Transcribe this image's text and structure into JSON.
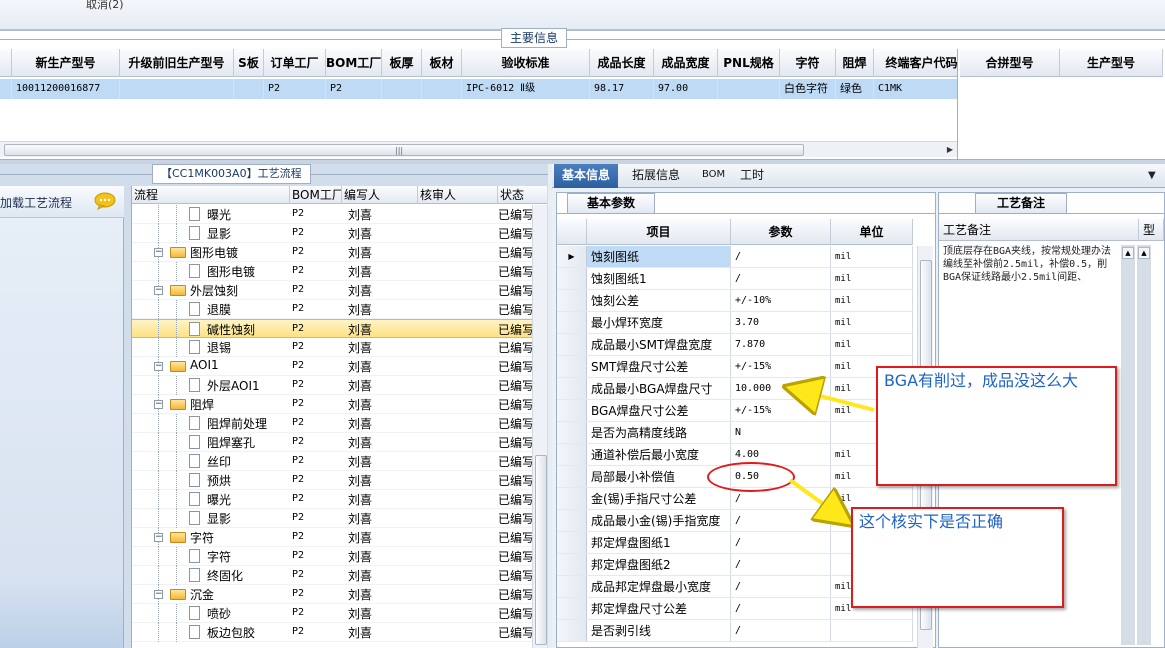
{
  "top": {
    "cancel_label": "取消(2)"
  },
  "main_info": {
    "legend": "主要信息",
    "columns": [
      "新生产型号",
      "升级前旧生产型号",
      "S板",
      "订单工厂",
      "BOM工厂",
      "板厚",
      "板材",
      "验收标准",
      "成品长度",
      "成品宽度",
      "PNL规格",
      "字符",
      "阻焊",
      "终端客户代码"
    ],
    "row": [
      "10011200016877",
      "",
      "",
      "P2",
      "P2",
      "",
      "",
      "IPC-6012 Ⅱ级",
      "98.17",
      "97.00",
      "",
      "白色字符",
      "绿色",
      "C1MK"
    ],
    "right_columns": [
      "合拼型号",
      "生产型号"
    ]
  },
  "flow": {
    "title": "【CC1MK003A0】工艺流程",
    "load_label": "加载工艺流程",
    "columns": [
      "流程",
      "BOM工厂",
      "编写人",
      "核审人",
      "状态"
    ],
    "rows": [
      {
        "name": "曝光",
        "level": 2,
        "type": "doc",
        "bom": "P2",
        "author": "刘喜",
        "status": "已编写"
      },
      {
        "name": "显影",
        "level": 2,
        "type": "doc",
        "bom": "P2",
        "author": "刘喜",
        "status": "已编写"
      },
      {
        "name": "图形电镀",
        "level": 1,
        "type": "folder",
        "bom": "P2",
        "author": "刘喜",
        "status": "已编写"
      },
      {
        "name": "图形电镀",
        "level": 2,
        "type": "doc",
        "bom": "P2",
        "author": "刘喜",
        "status": "已编写"
      },
      {
        "name": "外层蚀刻",
        "level": 1,
        "type": "folder",
        "bom": "P2",
        "author": "刘喜",
        "status": "已编写"
      },
      {
        "name": "退膜",
        "level": 2,
        "type": "doc",
        "bom": "P2",
        "author": "刘喜",
        "status": "已编写"
      },
      {
        "name": "碱性蚀刻",
        "level": 2,
        "type": "doc",
        "bom": "P2",
        "author": "刘喜",
        "status": "已编写",
        "selected": true
      },
      {
        "name": "退锡",
        "level": 2,
        "type": "doc",
        "bom": "P2",
        "author": "刘喜",
        "status": "已编写"
      },
      {
        "name": "AOI1",
        "level": 1,
        "type": "folder",
        "bom": "P2",
        "author": "刘喜",
        "status": "已编写"
      },
      {
        "name": "外层AOI1",
        "level": 2,
        "type": "doc",
        "bom": "P2",
        "author": "刘喜",
        "status": "已编写"
      },
      {
        "name": "阻焊",
        "level": 1,
        "type": "folder",
        "bom": "P2",
        "author": "刘喜",
        "status": "已编写"
      },
      {
        "name": "阻焊前处理",
        "level": 2,
        "type": "doc",
        "bom": "P2",
        "author": "刘喜",
        "status": "已编写"
      },
      {
        "name": "阻焊塞孔",
        "level": 2,
        "type": "doc",
        "bom": "P2",
        "author": "刘喜",
        "status": "已编写"
      },
      {
        "name": "丝印",
        "level": 2,
        "type": "doc",
        "bom": "P2",
        "author": "刘喜",
        "status": "已编写"
      },
      {
        "name": "预烘",
        "level": 2,
        "type": "doc",
        "bom": "P2",
        "author": "刘喜",
        "status": "已编写"
      },
      {
        "name": "曝光",
        "level": 2,
        "type": "doc",
        "bom": "P2",
        "author": "刘喜",
        "status": "已编写"
      },
      {
        "name": "显影",
        "level": 2,
        "type": "doc",
        "bom": "P2",
        "author": "刘喜",
        "status": "已编写"
      },
      {
        "name": "字符",
        "level": 1,
        "type": "folder",
        "bom": "P2",
        "author": "刘喜",
        "status": "已编写"
      },
      {
        "name": "字符",
        "level": 2,
        "type": "doc",
        "bom": "P2",
        "author": "刘喜",
        "status": "已编写"
      },
      {
        "name": "终固化",
        "level": 2,
        "type": "doc",
        "bom": "P2",
        "author": "刘喜",
        "status": "已编写"
      },
      {
        "name": "沉金",
        "level": 1,
        "type": "folder",
        "bom": "P2",
        "author": "刘喜",
        "status": "已编写"
      },
      {
        "name": "喷砂",
        "level": 2,
        "type": "doc",
        "bom": "P2",
        "author": "刘喜",
        "status": "已编写"
      },
      {
        "name": "板边包胶",
        "level": 2,
        "type": "doc",
        "bom": "P2",
        "author": "刘喜",
        "status": "已编写"
      }
    ]
  },
  "detail": {
    "tabs": [
      "基本信息",
      "拓展信息",
      "BOM",
      "工时"
    ],
    "params_tab": "基本参数",
    "params_columns": [
      "项目",
      "参数",
      "单位"
    ],
    "params": [
      {
        "item": "蚀刻图纸",
        "value": "/",
        "unit": "mil"
      },
      {
        "item": "蚀刻图纸1",
        "value": "/",
        "unit": "mil"
      },
      {
        "item": "蚀刻公差",
        "value": "+/-10%",
        "unit": "mil"
      },
      {
        "item": "最小焊环宽度",
        "value": "3.70",
        "unit": "mil"
      },
      {
        "item": "成品最小SMT焊盘宽度",
        "value": "7.870",
        "unit": "mil"
      },
      {
        "item": "SMT焊盘尺寸公差",
        "value": "+/-15%",
        "unit": "mil"
      },
      {
        "item": "成品最小BGA焊盘尺寸",
        "value": "10.000",
        "unit": "mil"
      },
      {
        "item": "BGA焊盘尺寸公差",
        "value": "+/-15%",
        "unit": "mil"
      },
      {
        "item": "是否为高精度线路",
        "value": "N",
        "unit": ""
      },
      {
        "item": "通道补偿后最小宽度",
        "value": "4.00",
        "unit": "mil"
      },
      {
        "item": "局部最小补偿值",
        "value": "0.50",
        "unit": "mil"
      },
      {
        "item": "金(锡)手指尺寸公差",
        "value": "/",
        "unit": "mil"
      },
      {
        "item": "成品最小金(锡)手指宽度",
        "value": "/",
        "unit": ""
      },
      {
        "item": "邦定焊盘图纸1",
        "value": "/",
        "unit": ""
      },
      {
        "item": "邦定焊盘图纸2",
        "value": "/",
        "unit": ""
      },
      {
        "item": "成品邦定焊盘最小宽度",
        "value": "/",
        "unit": "mil"
      },
      {
        "item": "邦定焊盘尺寸公差",
        "value": "/",
        "unit": "mil"
      },
      {
        "item": "是否剥引线",
        "value": "/",
        "unit": ""
      }
    ],
    "notes_tab": "工艺备注",
    "notes_columns": [
      "工艺备注",
      "型"
    ],
    "notes_text": "顶底层存在BGA夹线，按常规处理办法编线至补偿前2.5mil，补偿0.5，削BGA保证线路最小2.5mil间距、"
  },
  "annotations": {
    "callout_1": "BGA有削过，成品没这么大",
    "callout_2": "这个核实下是否正确"
  },
  "colors": {
    "accent": "#2c5f9e",
    "selection": "#bedaf5",
    "annotation_red": "#e01b1b",
    "annotation_text": "#1e63c8"
  }
}
